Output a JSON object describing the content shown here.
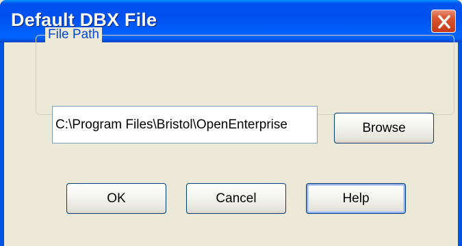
{
  "window": {
    "title": "Default DBX File"
  },
  "titlebar": {
    "close_icon": "close-icon"
  },
  "file_path_group": {
    "label": "File Path",
    "path_value": "C:\\Program Files\\Bristol\\OpenEnterprise",
    "browse_label": "Browse"
  },
  "buttons": {
    "ok_label": "OK",
    "cancel_label": "Cancel",
    "help_label": "Help"
  },
  "colors": {
    "titlebar_blue": "#0054e3",
    "close_red": "#d9552f",
    "dialog_face": "#ece9d8",
    "group_label": "#0046d5"
  }
}
